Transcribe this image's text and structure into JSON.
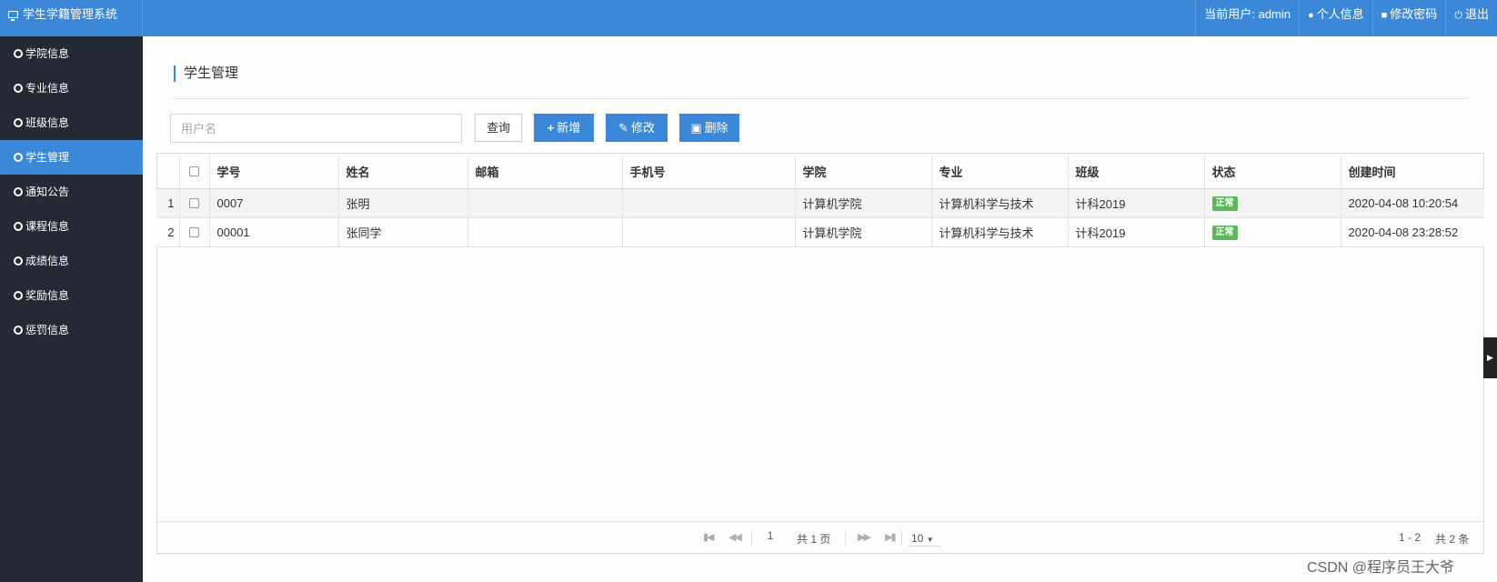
{
  "app": {
    "title": "学生学籍管理系统",
    "icon": "monitor-icon"
  },
  "header": {
    "current_user": "当前用户: admin",
    "profile": "个人信息",
    "change_password": "修改密码",
    "logout": "退出"
  },
  "sidebar": {
    "items": [
      {
        "label": "学院信息",
        "active": false
      },
      {
        "label": "专业信息",
        "active": false
      },
      {
        "label": "班级信息",
        "active": false
      },
      {
        "label": "学生管理",
        "active": true
      },
      {
        "label": "通知公告",
        "active": false
      },
      {
        "label": "课程信息",
        "active": false
      },
      {
        "label": "成绩信息",
        "active": false
      },
      {
        "label": "奖励信息",
        "active": false
      },
      {
        "label": "惩罚信息",
        "active": false
      }
    ]
  },
  "page": {
    "title": "学生管理"
  },
  "toolbar": {
    "search_placeholder": "用户名",
    "query": "查询",
    "add": "新增",
    "edit": "修改",
    "delete": "删除"
  },
  "table": {
    "columns": [
      "学号",
      "姓名",
      "邮箱",
      "手机号",
      "学院",
      "专业",
      "班级",
      "状态",
      "创建时间"
    ],
    "rows": [
      {
        "index": "1",
        "id": "0007",
        "name": "张明",
        "email": "",
        "phone": "",
        "college": "计算机学院",
        "major": "计算机科学与技术",
        "class": "计科2019",
        "status": "正常",
        "created": "2020-04-08 10:20:54"
      },
      {
        "index": "2",
        "id": "00001",
        "name": "张同学",
        "email": "",
        "phone": "",
        "college": "计算机学院",
        "major": "计算机科学与技术",
        "class": "计科2019",
        "status": "正常",
        "created": "2020-04-08 23:28:52"
      }
    ]
  },
  "pagination": {
    "current_page": "1",
    "total_pages": "共 1 页",
    "page_size": "10",
    "range": "1 - 2",
    "total": "共 2 条"
  },
  "watermark": "CSDN @程序员王大爷",
  "colors": {
    "accent": "#3b88d8",
    "sidebar": "#242a33",
    "status_ok": "#5cb85c"
  }
}
